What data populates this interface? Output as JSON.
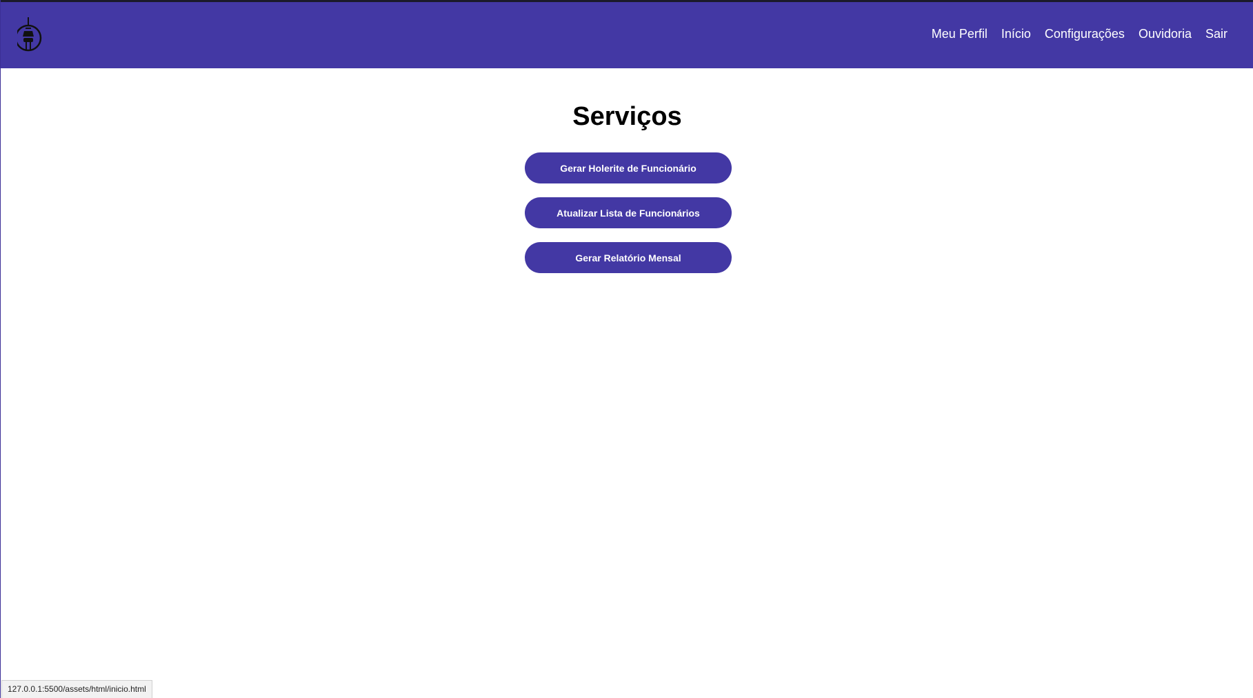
{
  "header": {
    "logo_icon": "tower-icon",
    "nav": [
      {
        "label": "Meu Perfil"
      },
      {
        "label": "Início"
      },
      {
        "label": "Configurações"
      },
      {
        "label": "Ouvidoria"
      },
      {
        "label": "Sair"
      }
    ],
    "bg_color": "#4338a4"
  },
  "main": {
    "title": "Serviços",
    "buttons": [
      {
        "label": "Gerar Holerite de Funcionário"
      },
      {
        "label": "Atualizar Lista de Funcionários"
      },
      {
        "label": "Gerar Relatório Mensal"
      }
    ]
  },
  "status_bar": {
    "url": "127.0.0.1:5500/assets/html/inicio.html"
  }
}
